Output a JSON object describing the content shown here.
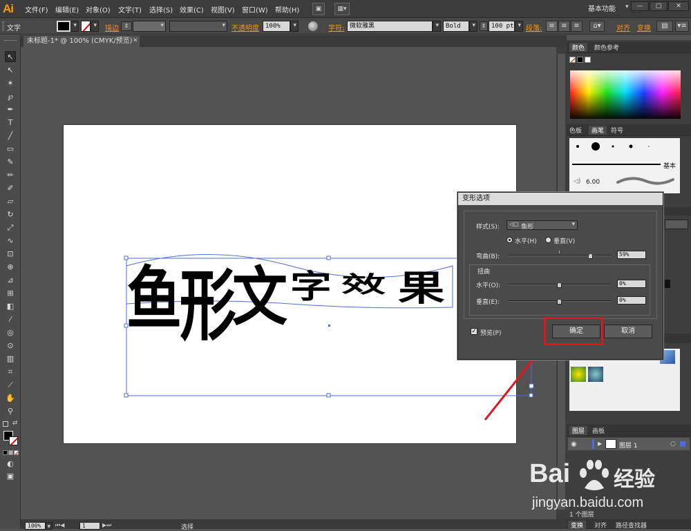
{
  "app": {
    "logo": "Ai",
    "workspace": "基本功能"
  },
  "menu": [
    "文件(F)",
    "编辑(E)",
    "对象(O)",
    "文字(T)",
    "选择(S)",
    "效果(C)",
    "视图(V)",
    "窗口(W)",
    "帮助(H)"
  ],
  "window": {
    "minimize": "—",
    "maximize": "□",
    "close": "✕"
  },
  "control_bar": {
    "tool_label": "文字",
    "stroke_label": "描边",
    "opacity_label": "不透明度",
    "opacity_value": "100%",
    "char_label": "字符:",
    "font_name": "微软雅黑",
    "font_style": "Bold",
    "font_size": "100 pt",
    "para_label": "段落:",
    "align_label": "对齐",
    "transform_label": "变换"
  },
  "document": {
    "tab_title": "未标题-1* @ 100% (CMYK/预览)",
    "tab_close": "✕"
  },
  "artwork": {
    "chars": [
      "鱼",
      "形",
      "文",
      "字",
      "效",
      "果"
    ]
  },
  "status": {
    "zoom": "100%",
    "artboard": "1",
    "mode": "选择"
  },
  "panels": {
    "color": {
      "tabs": [
        "颜色",
        "颜色参考"
      ]
    },
    "brushes": {
      "tabs": [
        "色板",
        "画笔",
        "符号"
      ],
      "basic_label": "基本",
      "size_value": "6.00"
    },
    "layers": {
      "tabs": [
        "图层",
        "画板"
      ],
      "layer_name": "图层 1",
      "count_text": "1 个图层"
    },
    "bottom_tabs": [
      "变换",
      "对齐",
      "路径查找器"
    ]
  },
  "dialog": {
    "title": "变形选项",
    "style_label": "样式(S):",
    "style_value": "鱼形",
    "horizontal_radio": "水平(H)",
    "vertical_radio": "垂直(V)",
    "bend_label": "弯曲(B):",
    "bend_value": "59%",
    "bend_fraction": 0.795,
    "distort_title": "扭曲",
    "distort_h_label": "水平(O):",
    "distort_h_value": "0%",
    "distort_v_label": "垂直(E):",
    "distort_v_value": "0%",
    "preview_label": "预览(P)",
    "ok_label": "确定",
    "cancel_label": "取消"
  },
  "watermark": {
    "brand": "Bai",
    "brand2": "经验",
    "url": "jingyan.baidu.com"
  },
  "accent_colors": {
    "highlight": "#e0141a",
    "logo": "#ff9a00",
    "selection": "#4a6ee0"
  }
}
